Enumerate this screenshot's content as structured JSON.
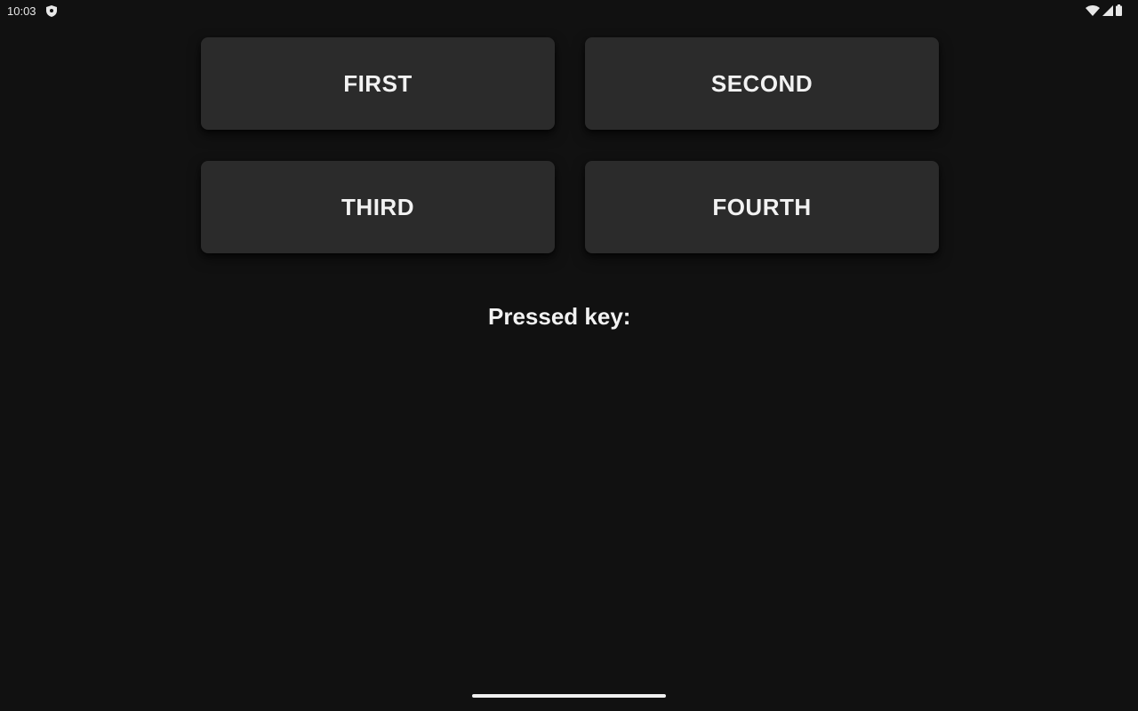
{
  "status_bar": {
    "time": "10:03",
    "icons": [
      "shield-icon",
      "wifi-icon",
      "signal-icon",
      "battery-icon"
    ]
  },
  "buttons": {
    "first": "FIRST",
    "second": "SECOND",
    "third": "THIRD",
    "fourth": "FOURTH"
  },
  "pressed": {
    "label": "Pressed key:",
    "value": ""
  },
  "colors": {
    "background": "#111111",
    "button": "#2b2b2b",
    "text": "#f2f2f2"
  }
}
